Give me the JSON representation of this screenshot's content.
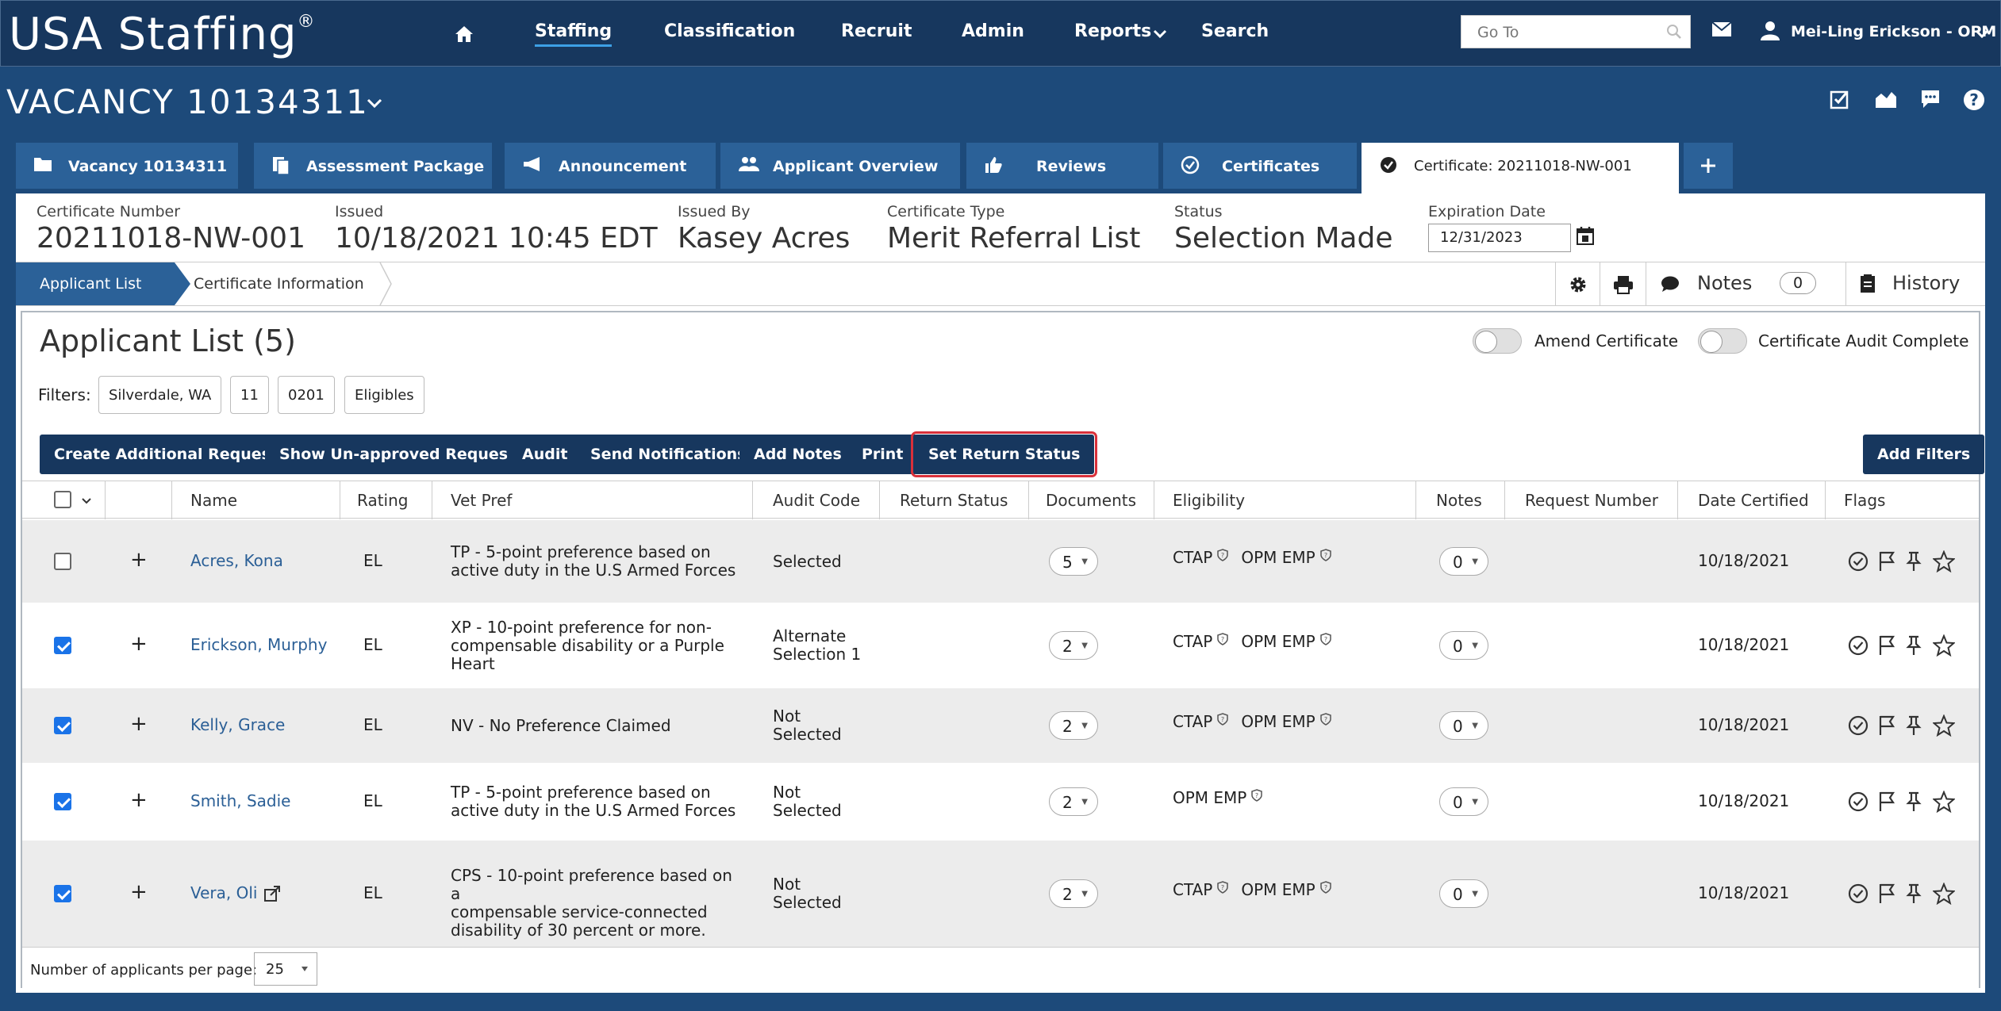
{
  "brand": {
    "name": "USA Staffing",
    "reg": "®"
  },
  "nav": {
    "items": [
      "Staffing",
      "Classification",
      "Recruit",
      "Admin",
      "Reports",
      "Search"
    ]
  },
  "goto": {
    "placeholder": "Go To"
  },
  "user": {
    "name": "Mei-Ling Erickson - OPM"
  },
  "vacancy": {
    "title": "VACANCY 10134311"
  },
  "tabs": [
    "Vacancy 10134311",
    "Assessment Package",
    "Announcement",
    "Applicant Overview",
    "Reviews",
    "Certificates",
    "Certificate: 20211018-NW-001"
  ],
  "cert": {
    "number_label": "Certificate Number",
    "number": "20211018-NW-001",
    "issued_label": "Issued",
    "issued": "10/18/2021 10:45 EDT",
    "issuedby_label": "Issued By",
    "issuedby": "Kasey Acres",
    "type_label": "Certificate Type",
    "type": "Merit Referral List",
    "status_label": "Status",
    "status": "Selection Made",
    "exp_label": "Expiration Date",
    "exp": "12/31/2023"
  },
  "subnav": {
    "crumb1": "Applicant List",
    "crumb2": "Certificate Information",
    "notes": "Notes",
    "notes_count": "0",
    "history": "History"
  },
  "list": {
    "title": "Applicant List (5)",
    "toggle1": "Amend Certificate",
    "toggle2": "Certificate Audit Complete",
    "filters_label": "Filters:",
    "filters": [
      "Silverdale, WA",
      "11",
      "0201",
      "Eligibles"
    ],
    "buttons": [
      "Create Additional Requests",
      "Show Un-approved Requests",
      "Audit",
      "Send Notifications",
      "Add Notes",
      "Print",
      "Set Return Status"
    ],
    "add_filters": "Add Filters",
    "columns": [
      "Name",
      "Rating",
      "Vet Pref",
      "Audit Code",
      "Return Status",
      "Documents",
      "Eligibility",
      "Notes",
      "Request Number",
      "Date Certified",
      "Flags"
    ],
    "rows": [
      {
        "checked": false,
        "name": "Acres, Kona",
        "rating": "EL",
        "vet": [
          "TP - 5-point preference based on",
          "active duty in the U.S Armed Forces"
        ],
        "audit": [
          "Selected"
        ],
        "docs": "5",
        "elig": [
          "CTAP",
          "OPM EMP"
        ],
        "notes": "0",
        "date": "10/18/2021"
      },
      {
        "checked": true,
        "name": "Erickson, Murphy",
        "rating": "EL",
        "vet": [
          "XP - 10-point preference for non-",
          "compensable disability or a Purple",
          "Heart"
        ],
        "audit": [
          "Alternate",
          "Selection 1"
        ],
        "docs": "2",
        "elig": [
          "CTAP",
          "OPM EMP"
        ],
        "notes": "0",
        "date": "10/18/2021"
      },
      {
        "checked": true,
        "name": "Kelly, Grace",
        "rating": "EL",
        "vet": [
          "NV - No Preference Claimed"
        ],
        "audit": [
          "Not",
          "Selected"
        ],
        "docs": "2",
        "elig": [
          "CTAP",
          "OPM EMP"
        ],
        "notes": "0",
        "date": "10/18/2021"
      },
      {
        "checked": true,
        "name": "Smith, Sadie",
        "rating": "EL",
        "vet": [
          "TP - 5-point preference based on",
          "active duty in the U.S Armed Forces"
        ],
        "audit": [
          "Not",
          "Selected"
        ],
        "docs": "2",
        "elig": [
          "OPM EMP"
        ],
        "notes": "0",
        "date": "10/18/2021"
      },
      {
        "checked": true,
        "name": "Vera, Oli",
        "rating": "EL",
        "vet": [
          "CPS - 10-point preference based on a",
          "compensable service-connected",
          "disability of 30 percent or more."
        ],
        "audit": [
          "Not",
          "Selected"
        ],
        "docs": "2",
        "elig": [
          "CTAP",
          "OPM EMP"
        ],
        "notes": "0",
        "date": "10/18/2021"
      }
    ],
    "per_page_label": "Number of applicants per page:",
    "per_page": "25"
  }
}
